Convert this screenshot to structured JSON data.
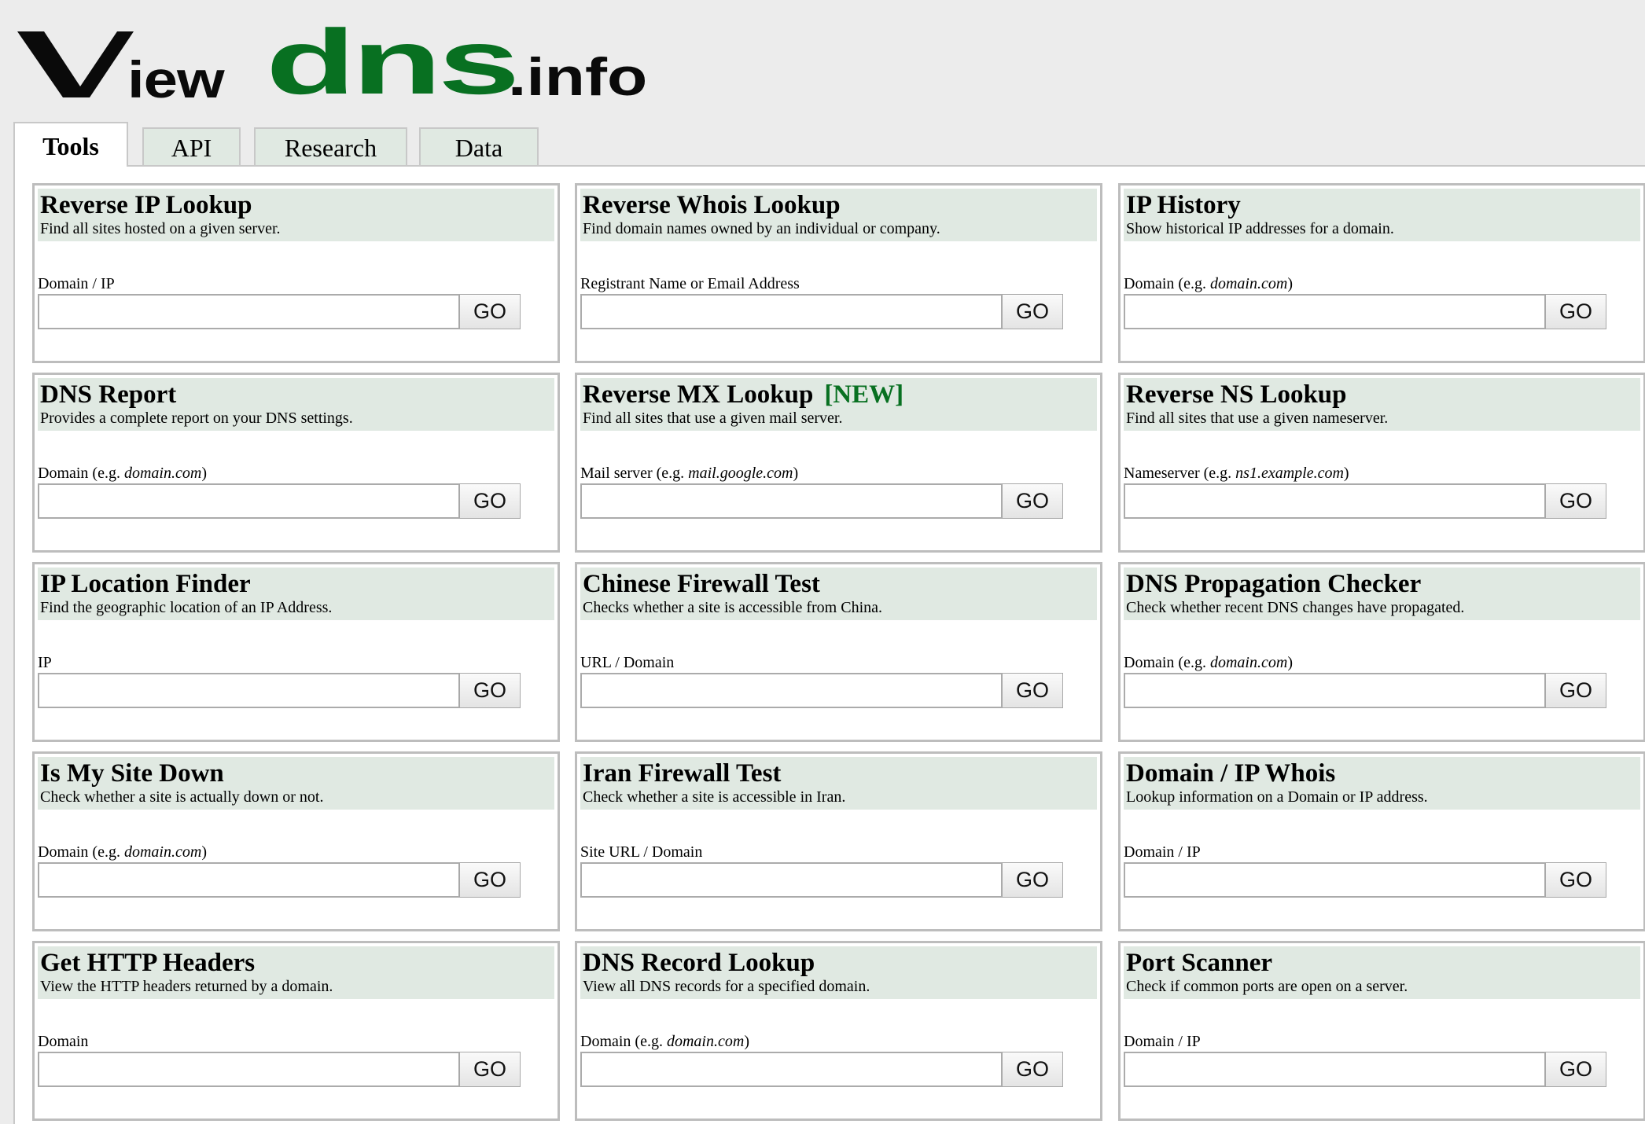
{
  "logo": {
    "part_view_v": "V",
    "part_view_rest": "iew",
    "part_dns": "dns",
    "part_info": ".info",
    "colors": {
      "dark": "#0a0a0a",
      "green": "#087021"
    }
  },
  "tabs": [
    {
      "label": "Tools",
      "active": true
    },
    {
      "label": "API",
      "active": false
    },
    {
      "label": "Research",
      "active": false
    },
    {
      "label": "Data",
      "active": false
    }
  ],
  "colors": {
    "page_background": "#ececec",
    "card_header_background": "#e0e9e2",
    "new_badge": "#087021",
    "card_border": "#bdbdbd"
  },
  "tools": [
    {
      "title": "Reverse IP Lookup",
      "badge": "",
      "description": "Find all sites hosted on a given server.",
      "label": "Domain / IP",
      "label_example": "",
      "label_suffix": "",
      "input_value": "",
      "button": "GO"
    },
    {
      "title": "Reverse Whois Lookup",
      "badge": "",
      "description": "Find domain names owned by an individual or company.",
      "label": "Registrant Name or Email Address",
      "label_example": "",
      "label_suffix": "",
      "input_value": "",
      "button": "GO"
    },
    {
      "title": "IP History",
      "badge": "",
      "description": "Show historical IP addresses for a domain.",
      "label": "Domain (e.g. ",
      "label_example": "domain.com",
      "label_suffix": ")",
      "input_value": "",
      "button": "GO"
    },
    {
      "title": "DNS Report",
      "badge": "",
      "description": "Provides a complete report on your DNS settings.",
      "label": "Domain (e.g. ",
      "label_example": "domain.com",
      "label_suffix": ")",
      "input_value": "",
      "button": "GO"
    },
    {
      "title": "Reverse MX Lookup",
      "badge": "[NEW]",
      "description": "Find all sites that use a given mail server.",
      "label": "Mail server (e.g. ",
      "label_example": "mail.google.com",
      "label_suffix": ")",
      "input_value": "",
      "button": "GO"
    },
    {
      "title": "Reverse NS Lookup",
      "badge": "",
      "description": "Find all sites that use a given nameserver.",
      "label": "Nameserver (e.g. ",
      "label_example": "ns1.example.com",
      "label_suffix": ")",
      "input_value": "",
      "button": "GO"
    },
    {
      "title": "IP Location Finder",
      "badge": "",
      "description": "Find the geographic location of an IP Address.",
      "label": "IP",
      "label_example": "",
      "label_suffix": "",
      "input_value": "",
      "button": "GO"
    },
    {
      "title": "Chinese Firewall Test",
      "badge": "",
      "description": "Checks whether a site is accessible from China.",
      "label": "URL / Domain",
      "label_example": "",
      "label_suffix": "",
      "input_value": "",
      "button": "GO"
    },
    {
      "title": "DNS Propagation Checker",
      "badge": "",
      "description": "Check whether recent DNS changes have propagated.",
      "label": "Domain (e.g. ",
      "label_example": "domain.com",
      "label_suffix": ")",
      "input_value": "",
      "button": "GO"
    },
    {
      "title": "Is My Site Down",
      "badge": "",
      "description": "Check whether a site is actually down or not.",
      "label": "Domain (e.g. ",
      "label_example": "domain.com",
      "label_suffix": ")",
      "input_value": "",
      "button": "GO"
    },
    {
      "title": "Iran Firewall Test",
      "badge": "",
      "description": "Check whether a site is accessible in Iran.",
      "label": "Site URL / Domain",
      "label_example": "",
      "label_suffix": "",
      "input_value": "",
      "button": "GO"
    },
    {
      "title": "Domain / IP Whois",
      "badge": "",
      "description": "Lookup information on a Domain or IP address.",
      "label": "Domain / IP",
      "label_example": "",
      "label_suffix": "",
      "input_value": "",
      "button": "GO"
    },
    {
      "title": "Get HTTP Headers",
      "badge": "",
      "description": "View the HTTP headers returned by a domain.",
      "label": "Domain",
      "label_example": "",
      "label_suffix": "",
      "input_value": "",
      "button": "GO"
    },
    {
      "title": "DNS Record Lookup",
      "badge": "",
      "description": "View all DNS records for a specified domain.",
      "label": "Domain (e.g. ",
      "label_example": "domain.com",
      "label_suffix": ")",
      "input_value": "",
      "button": "GO"
    },
    {
      "title": "Port Scanner",
      "badge": "",
      "description": "Check if common ports are open on a server.",
      "label": "Domain / IP",
      "label_example": "",
      "label_suffix": "",
      "input_value": "",
      "button": "GO"
    }
  ]
}
